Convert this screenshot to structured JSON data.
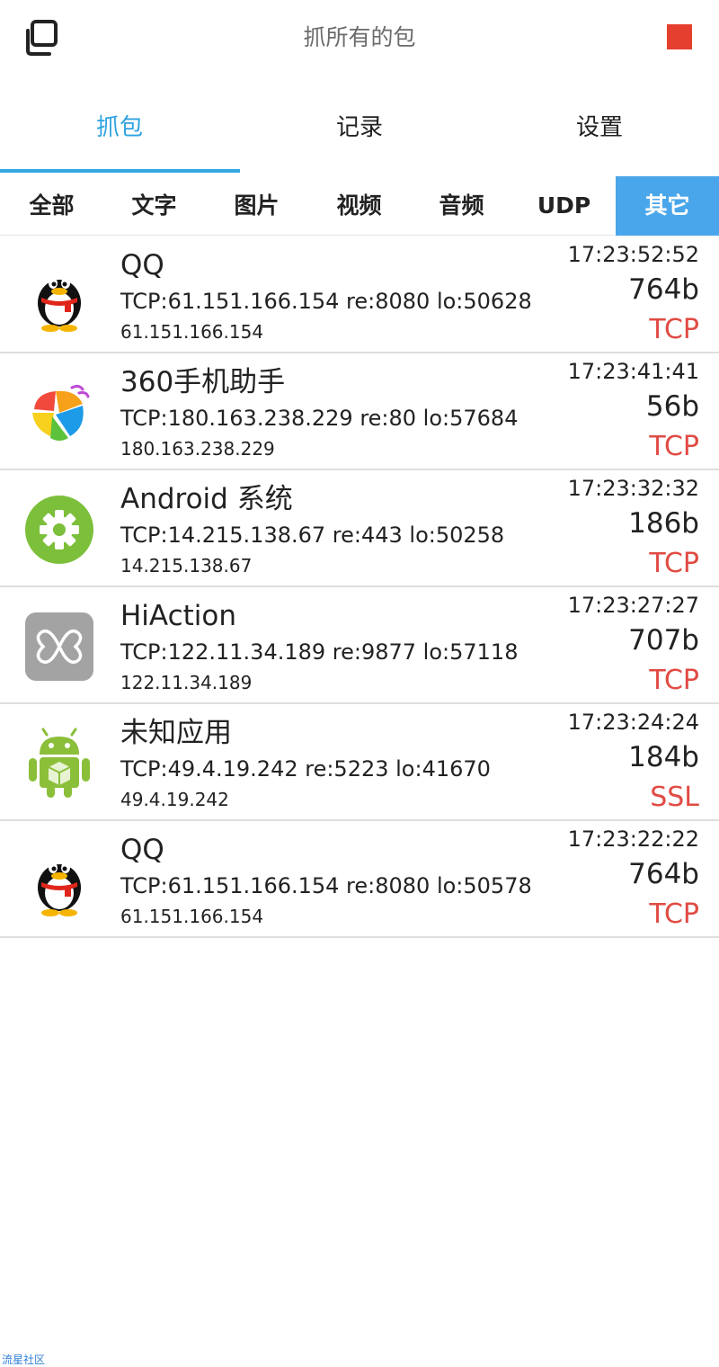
{
  "header": {
    "title": "抓所有的包",
    "left_icon": "copy-windows-icon",
    "right_icon": "stop-square-icon",
    "stop_color": "#e5402f"
  },
  "main_tabs": [
    {
      "label": "抓包",
      "active": true
    },
    {
      "label": "记录",
      "active": false
    },
    {
      "label": "设置",
      "active": false
    }
  ],
  "filter_tabs": [
    {
      "label": "全部",
      "active": false
    },
    {
      "label": "文字",
      "active": false
    },
    {
      "label": "图片",
      "active": false
    },
    {
      "label": "视频",
      "active": false
    },
    {
      "label": "音频",
      "active": false
    },
    {
      "label": "UDP",
      "active": false
    },
    {
      "label": "其它",
      "active": true
    }
  ],
  "packets": [
    {
      "app": "QQ",
      "icon": "qq-penguin-icon",
      "connection": "TCP:61.151.166.154 re:8080 lo:50628",
      "ip": "61.151.166.154",
      "time": "17:23:52:52",
      "size": "764b",
      "protocol": "TCP"
    },
    {
      "app": "360手机助手",
      "icon": "360-assistant-icon",
      "connection": "TCP:180.163.238.229 re:80 lo:57684",
      "ip": "180.163.238.229",
      "time": "17:23:41:41",
      "size": "56b",
      "protocol": "TCP"
    },
    {
      "app": "Android 系统",
      "icon": "android-system-gear-icon",
      "connection": "TCP:14.215.138.67 re:443 lo:50258",
      "ip": "14.215.138.67",
      "time": "17:23:32:32",
      "size": "186b",
      "protocol": "TCP"
    },
    {
      "app": "HiAction",
      "icon": "hiaction-icon",
      "connection": "TCP:122.11.34.189 re:9877 lo:57118",
      "ip": "122.11.34.189",
      "time": "17:23:27:27",
      "size": "707b",
      "protocol": "TCP"
    },
    {
      "app": "未知应用",
      "icon": "android-robot-icon",
      "connection": "TCP:49.4.19.242 re:5223 lo:41670",
      "ip": "49.4.19.242",
      "time": "17:23:24:24",
      "size": "184b",
      "protocol": "SSL"
    },
    {
      "app": "QQ",
      "icon": "qq-penguin-icon",
      "connection": "TCP:61.151.166.154 re:8080 lo:50578",
      "ip": "61.151.166.154",
      "time": "17:23:22:22",
      "size": "764b",
      "protocol": "TCP"
    }
  ],
  "colors": {
    "accent": "#2fa3e0",
    "active_filter_bg": "#4aa6ea",
    "protocol_text": "#e04b43"
  },
  "watermark": "流星社区"
}
